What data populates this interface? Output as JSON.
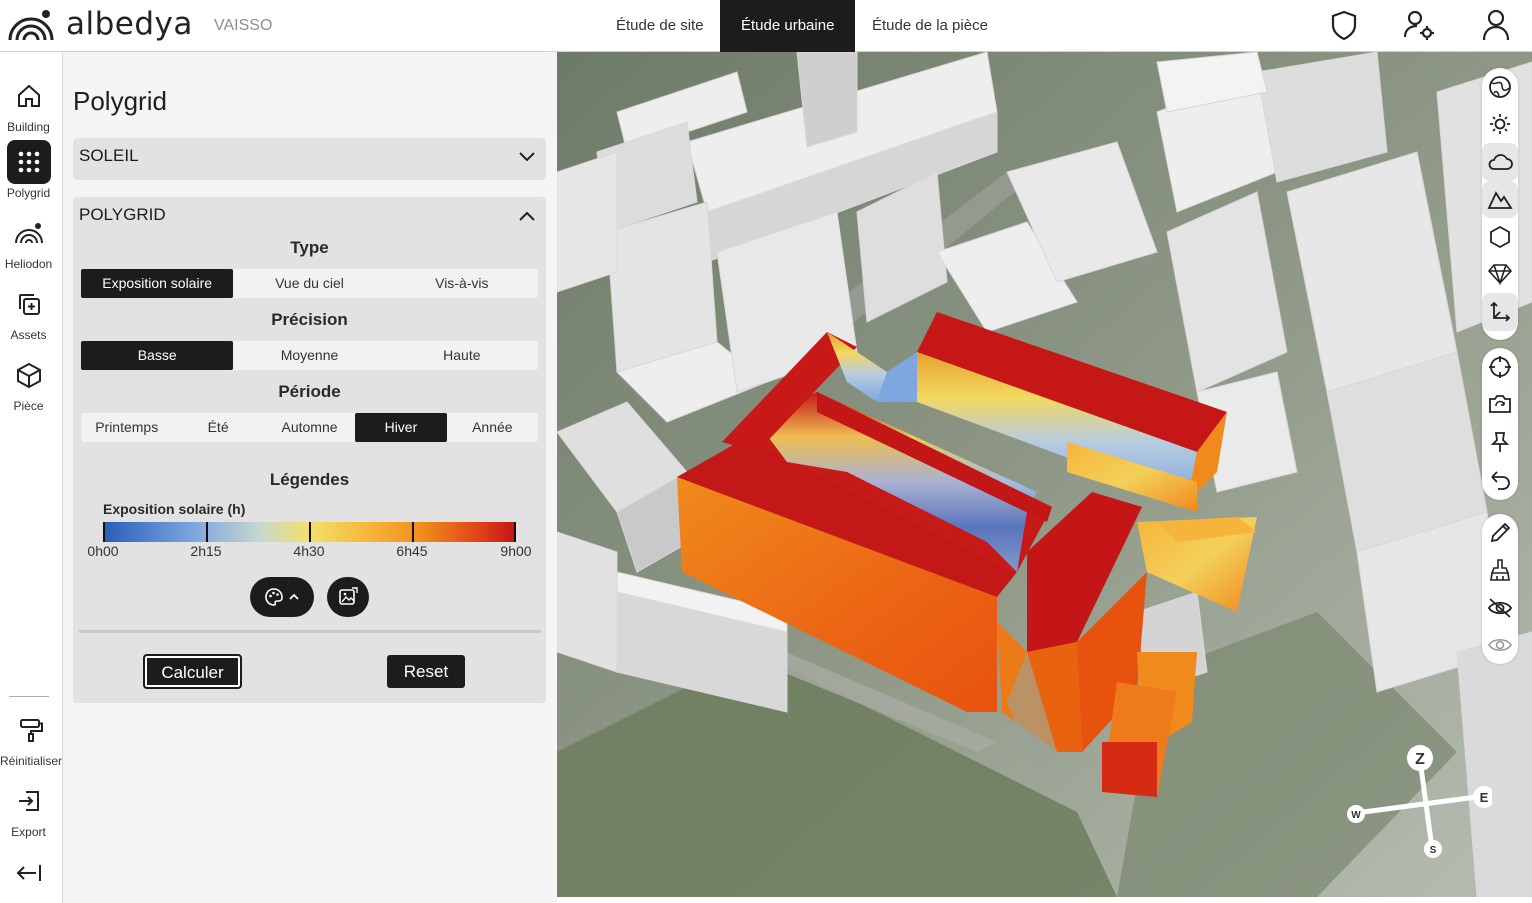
{
  "app": {
    "brand": "albedya",
    "project": "VAISSO"
  },
  "nav": {
    "tabs": [
      {
        "label": "Étude de site"
      },
      {
        "label": "Étude urbaine",
        "active": true
      },
      {
        "label": "Étude de la pièce"
      }
    ]
  },
  "top_icons": [
    "shield-icon",
    "user-settings-icon",
    "user-icon"
  ],
  "rail": {
    "items": [
      {
        "label": "Building",
        "icon": "home-icon"
      },
      {
        "label": "Polygrid",
        "icon": "grid-dots-icon",
        "active": true
      },
      {
        "label": "Heliodon",
        "icon": "heliodon-icon"
      },
      {
        "label": "Assets",
        "icon": "add-asset-icon"
      },
      {
        "label": "Pièce",
        "icon": "cube-icon"
      }
    ],
    "bottom": [
      {
        "label": "Réinitialiser",
        "icon": "paint-roller-icon"
      },
      {
        "label": "Export",
        "icon": "export-icon"
      }
    ],
    "collapse_icon": "collapse-left-icon"
  },
  "panel": {
    "title": "Polygrid",
    "soleil": {
      "label": "SOLEIL"
    },
    "polygrid": {
      "label": "POLYGRID",
      "type": {
        "title": "Type",
        "options": [
          "Exposition solaire",
          "Vue du ciel",
          "Vis-à-vis"
        ],
        "selected": "Exposition solaire"
      },
      "precision": {
        "title": "Précision",
        "options": [
          "Basse",
          "Moyenne",
          "Haute"
        ],
        "selected": "Basse"
      },
      "periode": {
        "title": "Période",
        "options": [
          "Printemps",
          "Été",
          "Automne",
          "Hiver",
          "Année"
        ],
        "selected": "Hiver"
      },
      "legend": {
        "title": "Légendes",
        "label": "Exposition solaire (h)",
        "ticks": [
          "0h00",
          "2h15",
          "4h30",
          "6h45",
          "9h00"
        ]
      },
      "buttons": {
        "calculer": "Calculer",
        "reset": "Reset"
      }
    }
  },
  "map_tools": {
    "group1": [
      "globe-icon",
      "sun-icon",
      "cloud-icon",
      "terrain-icon",
      "hexagon-icon",
      "diamond-icon",
      "axes-icon"
    ],
    "group2": [
      "target-icon",
      "camera-rotate-icon",
      "pin-icon",
      "undo-icon"
    ],
    "group3": [
      "pencil-icon",
      "broom-icon",
      "eye-off-icon",
      "eye-icon"
    ]
  },
  "compass": {
    "n": "Z",
    "e": "E",
    "w": "W",
    "s": "S"
  }
}
